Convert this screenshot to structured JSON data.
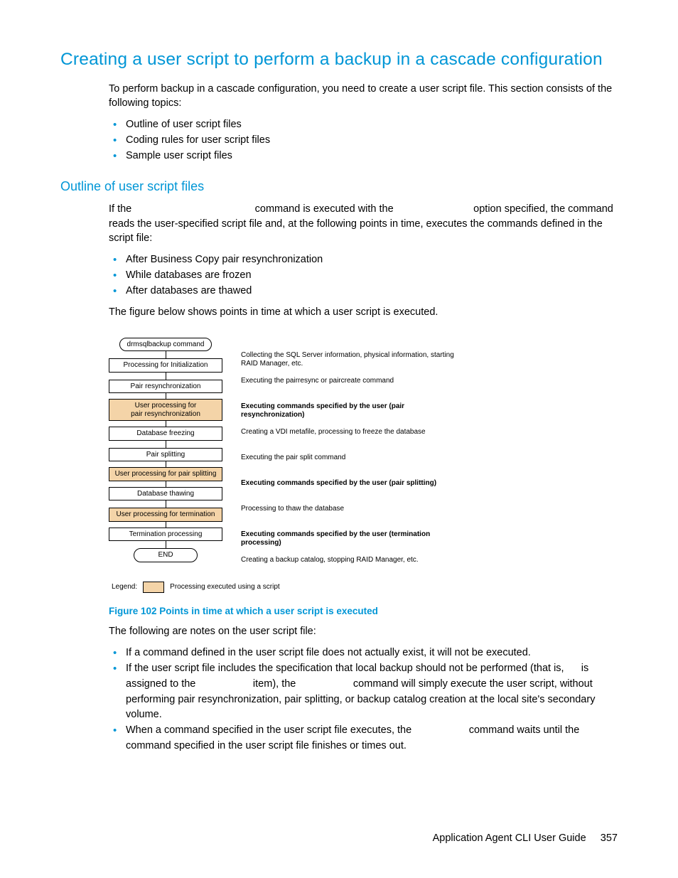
{
  "heading": "Creating a user script to perform a backup in a cascade configuration",
  "intro": "To perform backup in a cascade configuration, you need to create a user script file. This section consists of the following topics:",
  "intro_bullets": [
    "Outline of user script files",
    "Coding rules for user script files",
    "Sample user script files"
  ],
  "sub_heading": "Outline of user script files",
  "sub_intro_1": "If the ",
  "sub_intro_2": " command is executed with the ",
  "sub_intro_3": " option specified, the command reads the user-specified script file and, at the following points in time, executes the commands defined in the script file:",
  "timing_bullets": [
    "After Business Copy pair resynchronization",
    "While databases are frozen",
    "After databases are thawed"
  ],
  "fig_text": "The figure below shows points in time at which a user script is executed.",
  "flow": {
    "boxes": [
      {
        "label": "drmsqlbackup command",
        "type": "cmd"
      },
      {
        "label": "Processing for Initialization",
        "type": "plain"
      },
      {
        "label": "Pair resynchronization",
        "type": "plain"
      },
      {
        "label": "User processing for\npair resynchronization",
        "type": "user"
      },
      {
        "label": "Database freezing",
        "type": "plain"
      },
      {
        "label": "Pair splitting",
        "type": "plain"
      },
      {
        "label": "User processing for pair splitting",
        "type": "user"
      },
      {
        "label": "Database thawing",
        "type": "plain"
      },
      {
        "label": "User processing for termination",
        "type": "user"
      },
      {
        "label": "Termination processing",
        "type": "plain"
      },
      {
        "label": "END",
        "type": "end"
      }
    ],
    "descs": [
      {
        "text": "Collecting the SQL Server information, physical information,  starting RAID Manager, etc.",
        "bold": false
      },
      {
        "text": "Executing the pairresync or  paircreate command",
        "bold": false
      },
      {
        "text": "Executing commands specified by the user (pair resynchronization)",
        "bold": true
      },
      {
        "text": "Creating a VDI metafile, processing to freeze the database",
        "bold": false
      },
      {
        "text": "Executing the pair split command",
        "bold": false
      },
      {
        "text": "Executing commands specified by the user (pair splitting)",
        "bold": true
      },
      {
        "text": "Processing to thaw the database",
        "bold": false
      },
      {
        "text": "Executing commands specified by the user (termination processing)",
        "bold": true
      },
      {
        "text": "Creating a backup catalog, stopping RAID Manager, etc.",
        "bold": false
      }
    ],
    "legend_label": "Legend:",
    "legend_text": "Processing executed using a script"
  },
  "figure_caption": "Figure 102 Points in time at which a user script is executed",
  "notes_intro": "The following are notes on the user script file:",
  "notes": [
    "If a command defined in the user script file does not actually exist, it will not be executed.",
    "If the user script file includes the specification that local backup should not be performed (that is,      is assigned to the                    item), the                    command will simply execute the user script, without performing pair resynchronization, pair splitting, or backup catalog creation at the local site's secondary volume.",
    "When a command specified in the user script file executes, the                    command waits until the command specified in the user script file finishes or times out."
  ],
  "footer_title": "Application Agent CLI User Guide",
  "footer_page": "357"
}
